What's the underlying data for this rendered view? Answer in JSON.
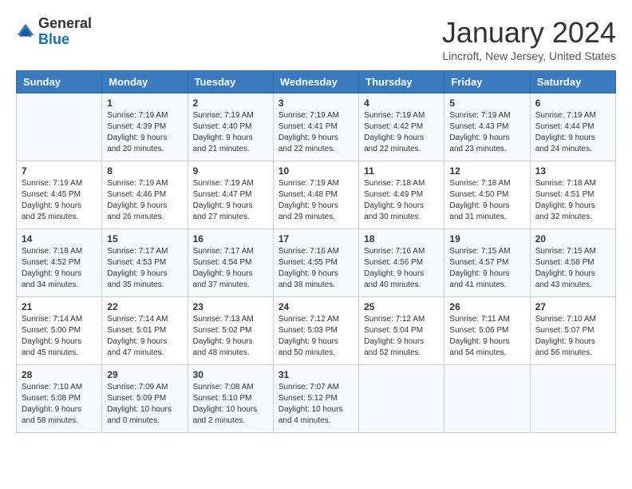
{
  "logo": {
    "general": "General",
    "blue": "Blue"
  },
  "header": {
    "title": "January 2024",
    "subtitle": "Lincroft, New Jersey, United States"
  },
  "days_of_week": [
    "Sunday",
    "Monday",
    "Tuesday",
    "Wednesday",
    "Thursday",
    "Friday",
    "Saturday"
  ],
  "weeks": [
    [
      {
        "day": "",
        "info": ""
      },
      {
        "day": "1",
        "info": "Sunrise: 7:19 AM\nSunset: 4:39 PM\nDaylight: 9 hours\nand 20 minutes."
      },
      {
        "day": "2",
        "info": "Sunrise: 7:19 AM\nSunset: 4:40 PM\nDaylight: 9 hours\nand 21 minutes."
      },
      {
        "day": "3",
        "info": "Sunrise: 7:19 AM\nSunset: 4:41 PM\nDaylight: 9 hours\nand 22 minutes."
      },
      {
        "day": "4",
        "info": "Sunrise: 7:19 AM\nSunset: 4:42 PM\nDaylight: 9 hours\nand 22 minutes."
      },
      {
        "day": "5",
        "info": "Sunrise: 7:19 AM\nSunset: 4:43 PM\nDaylight: 9 hours\nand 23 minutes."
      },
      {
        "day": "6",
        "info": "Sunrise: 7:19 AM\nSunset: 4:44 PM\nDaylight: 9 hours\nand 24 minutes."
      }
    ],
    [
      {
        "day": "7",
        "info": "Sunrise: 7:19 AM\nSunset: 4:45 PM\nDaylight: 9 hours\nand 25 minutes."
      },
      {
        "day": "8",
        "info": "Sunrise: 7:19 AM\nSunset: 4:46 PM\nDaylight: 9 hours\nand 26 minutes."
      },
      {
        "day": "9",
        "info": "Sunrise: 7:19 AM\nSunset: 4:47 PM\nDaylight: 9 hours\nand 27 minutes."
      },
      {
        "day": "10",
        "info": "Sunrise: 7:19 AM\nSunset: 4:48 PM\nDaylight: 9 hours\nand 29 minutes."
      },
      {
        "day": "11",
        "info": "Sunrise: 7:18 AM\nSunset: 4:49 PM\nDaylight: 9 hours\nand 30 minutes."
      },
      {
        "day": "12",
        "info": "Sunrise: 7:18 AM\nSunset: 4:50 PM\nDaylight: 9 hours\nand 31 minutes."
      },
      {
        "day": "13",
        "info": "Sunrise: 7:18 AM\nSunset: 4:51 PM\nDaylight: 9 hours\nand 32 minutes."
      }
    ],
    [
      {
        "day": "14",
        "info": "Sunrise: 7:18 AM\nSunset: 4:52 PM\nDaylight: 9 hours\nand 34 minutes."
      },
      {
        "day": "15",
        "info": "Sunrise: 7:17 AM\nSunset: 4:53 PM\nDaylight: 9 hours\nand 35 minutes."
      },
      {
        "day": "16",
        "info": "Sunrise: 7:17 AM\nSunset: 4:54 PM\nDaylight: 9 hours\nand 37 minutes."
      },
      {
        "day": "17",
        "info": "Sunrise: 7:16 AM\nSunset: 4:55 PM\nDaylight: 9 hours\nand 38 minutes."
      },
      {
        "day": "18",
        "info": "Sunrise: 7:16 AM\nSunset: 4:56 PM\nDaylight: 9 hours\nand 40 minutes."
      },
      {
        "day": "19",
        "info": "Sunrise: 7:15 AM\nSunset: 4:57 PM\nDaylight: 9 hours\nand 41 minutes."
      },
      {
        "day": "20",
        "info": "Sunrise: 7:15 AM\nSunset: 4:58 PM\nDaylight: 9 hours\nand 43 minutes."
      }
    ],
    [
      {
        "day": "21",
        "info": "Sunrise: 7:14 AM\nSunset: 5:00 PM\nDaylight: 9 hours\nand 45 minutes."
      },
      {
        "day": "22",
        "info": "Sunrise: 7:14 AM\nSunset: 5:01 PM\nDaylight: 9 hours\nand 47 minutes."
      },
      {
        "day": "23",
        "info": "Sunrise: 7:13 AM\nSunset: 5:02 PM\nDaylight: 9 hours\nand 48 minutes."
      },
      {
        "day": "24",
        "info": "Sunrise: 7:12 AM\nSunset: 5:03 PM\nDaylight: 9 hours\nand 50 minutes."
      },
      {
        "day": "25",
        "info": "Sunrise: 7:12 AM\nSunset: 5:04 PM\nDaylight: 9 hours\nand 52 minutes."
      },
      {
        "day": "26",
        "info": "Sunrise: 7:11 AM\nSunset: 5:06 PM\nDaylight: 9 hours\nand 54 minutes."
      },
      {
        "day": "27",
        "info": "Sunrise: 7:10 AM\nSunset: 5:07 PM\nDaylight: 9 hours\nand 56 minutes."
      }
    ],
    [
      {
        "day": "28",
        "info": "Sunrise: 7:10 AM\nSunset: 5:08 PM\nDaylight: 9 hours\nand 58 minutes."
      },
      {
        "day": "29",
        "info": "Sunrise: 7:09 AM\nSunset: 5:09 PM\nDaylight: 10 hours\nand 0 minutes."
      },
      {
        "day": "30",
        "info": "Sunrise: 7:08 AM\nSunset: 5:10 PM\nDaylight: 10 hours\nand 2 minutes."
      },
      {
        "day": "31",
        "info": "Sunrise: 7:07 AM\nSunset: 5:12 PM\nDaylight: 10 hours\nand 4 minutes."
      },
      {
        "day": "",
        "info": ""
      },
      {
        "day": "",
        "info": ""
      },
      {
        "day": "",
        "info": ""
      }
    ]
  ]
}
